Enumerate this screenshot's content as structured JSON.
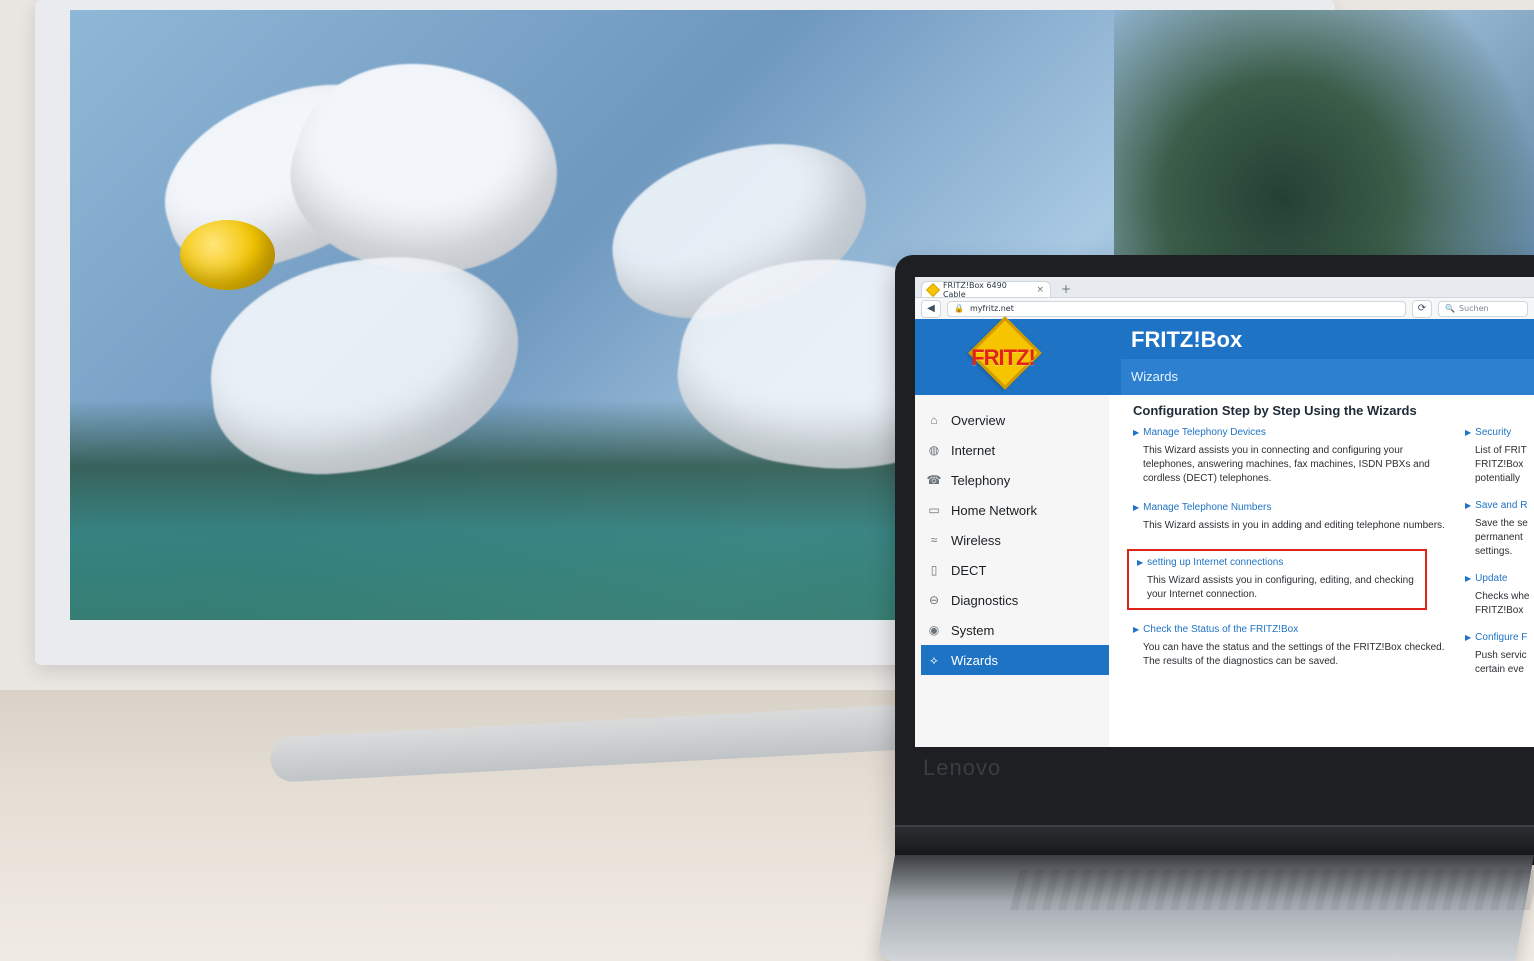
{
  "browser": {
    "tab_title": "FRITZ!Box 6490 Cable",
    "new_tab": "+",
    "address_host": "myfritz.net",
    "search_placeholder": "Suchen"
  },
  "fritz": {
    "logo_text": "FRITZ!",
    "header_title": "FRITZ!Box",
    "section_title": "Wizards",
    "menu": [
      {
        "label": "Overview",
        "icon": "home-icon"
      },
      {
        "label": "Internet",
        "icon": "globe-icon"
      },
      {
        "label": "Telephony",
        "icon": "phone-icon"
      },
      {
        "label": "Home Network",
        "icon": "network-icon"
      },
      {
        "label": "Wireless",
        "icon": "wifi-icon"
      },
      {
        "label": "DECT",
        "icon": "dect-icon"
      },
      {
        "label": "Diagnostics",
        "icon": "diagnostics-icon"
      },
      {
        "label": "System",
        "icon": "system-icon"
      },
      {
        "label": "Wizards",
        "icon": "wizard-icon",
        "active": true
      }
    ],
    "content": {
      "heading": "Configuration Step by Step Using the Wizards",
      "left": [
        {
          "link": "Manage Telephony Devices",
          "desc": "This Wizard assists you in connecting and configuring your telephones, answering machines, fax machines, ISDN PBXs and cordless (DECT) telephones."
        },
        {
          "link": "Manage Telephone Numbers",
          "desc": "This Wizard assists in you in adding and editing telephone numbers."
        },
        {
          "link": "setting up Internet connections",
          "desc": "This Wizard assists you in configuring, editing, and checking your Internet connection.",
          "highlighted": true
        },
        {
          "link": "Check the Status of the FRITZ!Box",
          "desc": "You can have the status and the settings of the FRITZ!Box checked. The results of the diagnostics can be saved."
        }
      ],
      "right": [
        {
          "link": "Security",
          "desc": "List of FRIT FRITZ!Box potentially"
        },
        {
          "link": "Save and R",
          "desc": "Save the se permanent settings."
        },
        {
          "link": "Update",
          "desc": "Checks whe FRITZ!Box"
        },
        {
          "link": "Configure F",
          "desc": "Push servic certain eve"
        }
      ]
    }
  },
  "device": {
    "brand": "Lenovo"
  }
}
